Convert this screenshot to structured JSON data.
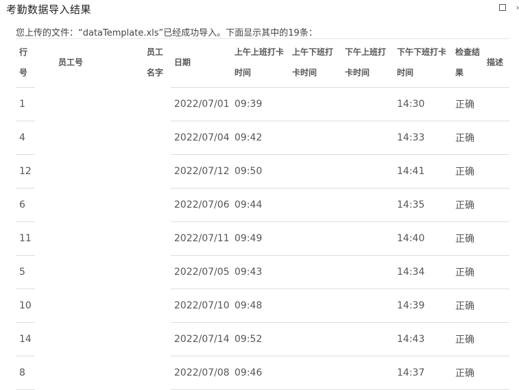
{
  "window": {
    "title": "考勤数据导入结果",
    "maximize_icon": "maximize-icon",
    "more_icon": "chevron-right-icon",
    "more_glyph": "›"
  },
  "info_text": "您上传的文件：“dataTemplate.xls”已经成功导入。下面显示其中的19条：",
  "table": {
    "headers": {
      "row": "行号",
      "emp_id": "员工号",
      "emp_name": "员工名字",
      "date": "日期",
      "am_in": "上午上班打卡时间",
      "am_out": "上午下班打卡时间",
      "pm_in": "下午上班打卡时间",
      "pm_out": "下午下班打卡时间",
      "result": "检查结果",
      "desc": "描述"
    },
    "rows": [
      {
        "row": "1",
        "emp_id": "",
        "emp_name": "",
        "date": "2022/07/01",
        "am_in": "09:39",
        "am_out": "",
        "pm_in": "",
        "pm_out": "14:30",
        "result": "正确",
        "desc": ""
      },
      {
        "row": "4",
        "emp_id": "",
        "emp_name": "",
        "date": "2022/07/04",
        "am_in": "09:42",
        "am_out": "",
        "pm_in": "",
        "pm_out": "14:33",
        "result": "正确",
        "desc": ""
      },
      {
        "row": "12",
        "emp_id": "",
        "emp_name": "",
        "date": "2022/07/12",
        "am_in": "09:50",
        "am_out": "",
        "pm_in": "",
        "pm_out": "14:41",
        "result": "正确",
        "desc": ""
      },
      {
        "row": "6",
        "emp_id": "",
        "emp_name": "",
        "date": "2022/07/06",
        "am_in": "09:44",
        "am_out": "",
        "pm_in": "",
        "pm_out": "14:35",
        "result": "正确",
        "desc": ""
      },
      {
        "row": "11",
        "emp_id": "",
        "emp_name": "",
        "date": "2022/07/11",
        "am_in": "09:49",
        "am_out": "",
        "pm_in": "",
        "pm_out": "14:40",
        "result": "正确",
        "desc": ""
      },
      {
        "row": "5",
        "emp_id": "",
        "emp_name": "",
        "date": "2022/07/05",
        "am_in": "09:43",
        "am_out": "",
        "pm_in": "",
        "pm_out": "14:34",
        "result": "正确",
        "desc": ""
      },
      {
        "row": "10",
        "emp_id": "",
        "emp_name": "",
        "date": "2022/07/10",
        "am_in": "09:48",
        "am_out": "",
        "pm_in": "",
        "pm_out": "14:39",
        "result": "正确",
        "desc": ""
      },
      {
        "row": "14",
        "emp_id": "",
        "emp_name": "",
        "date": "2022/07/14",
        "am_in": "09:52",
        "am_out": "",
        "pm_in": "",
        "pm_out": "14:43",
        "result": "正确",
        "desc": ""
      },
      {
        "row": "8",
        "emp_id": "",
        "emp_name": "",
        "date": "2022/07/08",
        "am_in": "09:46",
        "am_out": "",
        "pm_in": "",
        "pm_out": "14:37",
        "result": "正确",
        "desc": ""
      }
    ]
  }
}
